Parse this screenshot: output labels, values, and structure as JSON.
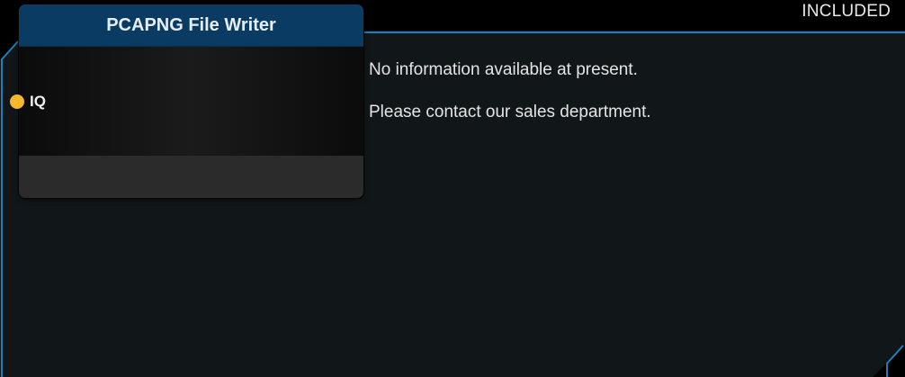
{
  "status": {
    "label": "INCLUDED"
  },
  "node": {
    "title": "PCAPNG File Writer",
    "ports": [
      {
        "label": "IQ",
        "color": "#f4b82e"
      }
    ]
  },
  "info": {
    "line1": "No information available at present.",
    "line2": "Please contact our sales department."
  },
  "colors": {
    "background": "#000000",
    "panel_fill": "#111718",
    "panel_border": "#1e7fbf",
    "node_header": "#0a3c63",
    "port": "#f4b82e"
  }
}
